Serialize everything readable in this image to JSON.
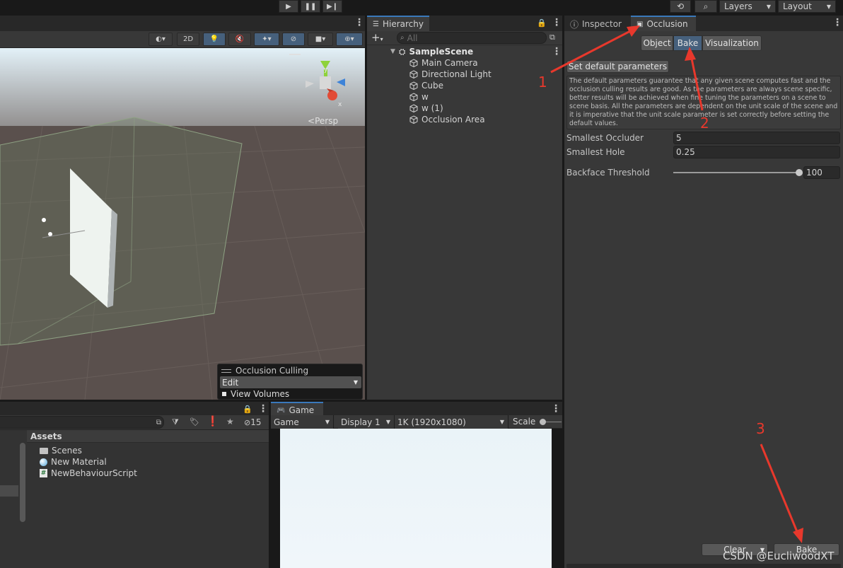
{
  "toolbar": {
    "play_icon": "play-icon",
    "pause_icon": "pause-icon",
    "step_icon": "step-icon",
    "layers_label": "Layers",
    "layout_label": "Layout"
  },
  "scene": {
    "btn_2d": "2D",
    "persp_label": "Persp",
    "overlay": {
      "title": "Occlusion Culling",
      "mode": "Edit",
      "view_volumes": "View Volumes"
    }
  },
  "hierarchy": {
    "tab_label": "Hierarchy",
    "search_placeholder": "All",
    "scene_name": "SampleScene",
    "items": [
      "Main Camera",
      "Directional Light",
      "Cube",
      "w",
      "w (1)",
      "Occlusion Area"
    ]
  },
  "inspector": {
    "tab_inspector": "Inspector",
    "tab_occlusion": "Occlusion",
    "subtabs": [
      "Object",
      "Bake",
      "Visualization"
    ],
    "selected_subtab": "Bake",
    "set_default_btn": "Set default parameters",
    "help_text": "The default parameters guarantee that any given scene computes fast and the occlusion culling results are good. As the parameters are always scene specific, better results will be achieved when fine tuning the parameters on a scene to scene basis. All the parameters are dependent on the unit scale of the scene and it is imperative that the unit scale parameter is set correctly before setting the default values.",
    "params": [
      {
        "label": "Smallest Occluder",
        "value": "5"
      },
      {
        "label": "Smallest Hole",
        "value": "0.25"
      }
    ],
    "backface": {
      "label": "Backface Threshold",
      "value": "100",
      "fill": 1.0
    },
    "clear_btn": "Clear",
    "bake_btn": "Bake"
  },
  "project": {
    "hidden_count": "15",
    "assets_label": "Assets",
    "items": [
      {
        "name": "Scenes",
        "icon": "folder-icon"
      },
      {
        "name": "New Material",
        "icon": "material-icon"
      },
      {
        "name": "NewBehaviourScript",
        "icon": "script-icon"
      }
    ]
  },
  "game": {
    "tab_label": "Game",
    "display_mode": "Game",
    "display": "Display 1",
    "resolution": "1K (1920x1080)",
    "scale_label": "Scale"
  },
  "annotations": {
    "step1": "1",
    "step2": "2",
    "step3": "3",
    "arrow_color": "#e8382c"
  },
  "watermark": "CSDN @EucliwoodXT",
  "colors": {
    "accent": "#3a79bb",
    "selected": "#46607c",
    "panel": "#383838",
    "field": "#2a2a2a"
  }
}
